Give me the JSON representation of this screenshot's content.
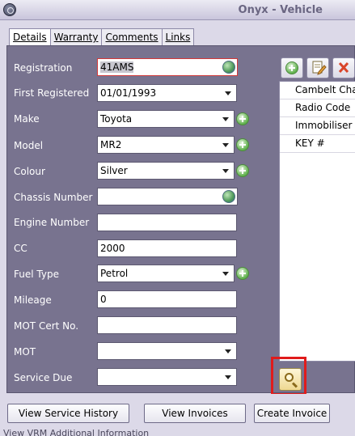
{
  "window": {
    "title": "Onyx - Vehicle"
  },
  "tabs": [
    {
      "label": "Details",
      "active": true
    },
    {
      "label": "Warranty",
      "active": false
    },
    {
      "label": "Comments",
      "active": false
    },
    {
      "label": "Links",
      "active": false
    }
  ],
  "form": {
    "registration": {
      "label": "Registration",
      "value": "41AMS"
    },
    "first_registered": {
      "label": "First Registered",
      "value": "01/01/1993"
    },
    "make": {
      "label": "Make",
      "value": "Toyota"
    },
    "model": {
      "label": "Model",
      "value": "MR2"
    },
    "colour": {
      "label": "Colour",
      "value": "Silver"
    },
    "chassis_number": {
      "label": "Chassis Number",
      "value": ""
    },
    "engine_number": {
      "label": "Engine Number",
      "value": ""
    },
    "cc": {
      "label": "CC",
      "value": "2000"
    },
    "fuel_type": {
      "label": "Fuel Type",
      "value": "Petrol"
    },
    "mileage": {
      "label": "Mileage",
      "value": "0"
    },
    "mot_cert_no": {
      "label": "MOT Cert No.",
      "value": ""
    },
    "mot": {
      "label": "MOT",
      "value": ""
    },
    "service_due": {
      "label": "Service Due",
      "value": ""
    }
  },
  "side_list": {
    "items": [
      "Cambelt Change",
      "Radio Code",
      "Immobiliser Code",
      "KEY #"
    ]
  },
  "buttons": {
    "view_service_history": "View Service History",
    "view_invoices": "View Invoices",
    "create_invoice": "Create Invoice"
  },
  "status_bar": {
    "text": "View VRM Additional Information"
  },
  "colors": {
    "form_background": "#78738f",
    "highlight_border": "#e01b1b",
    "add_icon": "#5fb04c"
  }
}
